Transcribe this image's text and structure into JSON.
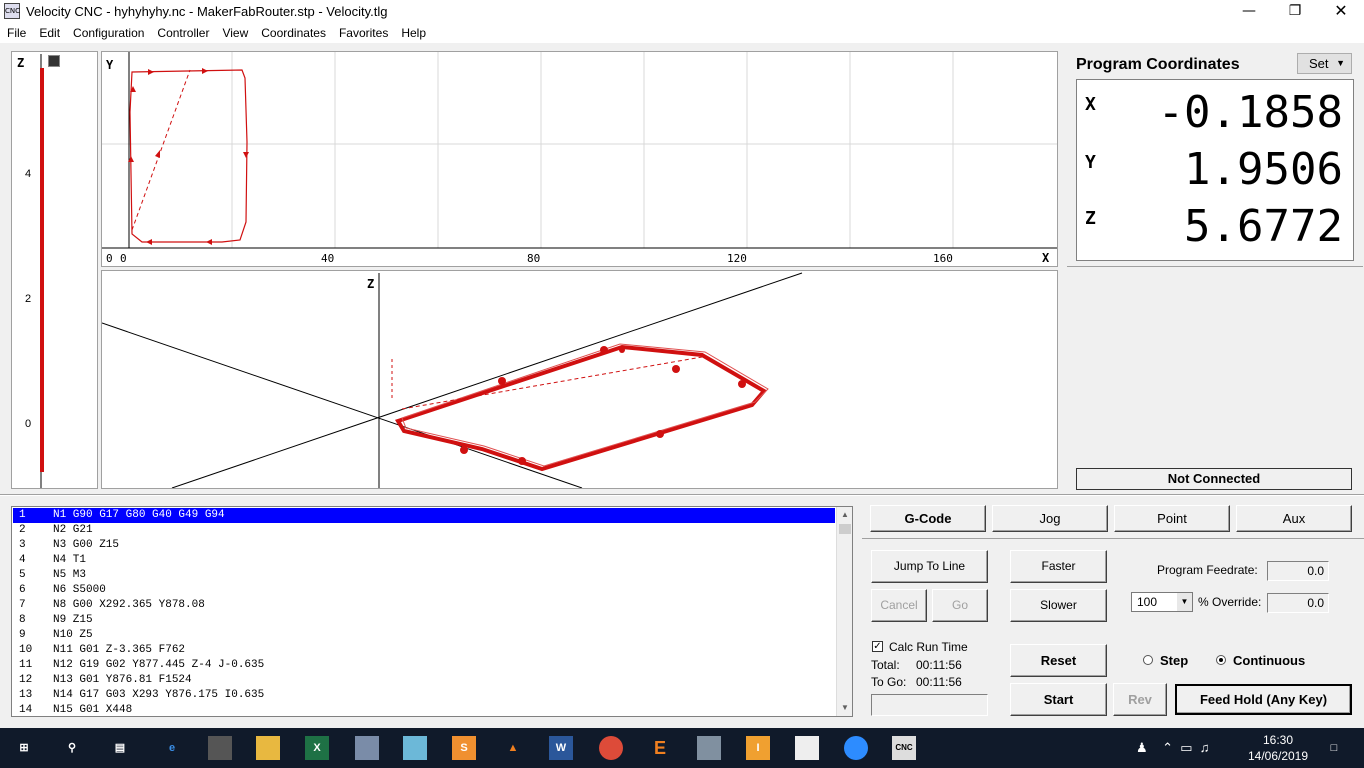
{
  "window": {
    "title": "Velocity CNC - hyhyhyhy.nc - MakerFabRouter.stp - Velocity.tlg",
    "app_icon_text": "CNC",
    "minimize_icon": "minimize-icon",
    "maximize_icon": "restore-icon",
    "close_icon": "close-icon"
  },
  "menu": [
    "File",
    "Edit",
    "Configuration",
    "Controller",
    "View",
    "Coordinates",
    "Favorites",
    "Help"
  ],
  "zbar": {
    "label": "Z",
    "ticks": [
      "4",
      "2",
      "0"
    ]
  },
  "topview": {
    "y_label": "Y",
    "x_label": "X",
    "x_ticks": [
      "0",
      "0",
      "40",
      "80",
      "120",
      "160"
    ]
  },
  "isoview": {
    "z_label": "Z"
  },
  "coords": {
    "title": "Program Coordinates",
    "set_label": "Set",
    "x_label": "X",
    "x_value": "-0.1858",
    "y_label": "Y",
    "y_value": "1.9506",
    "z_label": "Z",
    "z_value": "5.6772"
  },
  "status": "Not Connected",
  "gcode": {
    "lines": [
      {
        "n": "1",
        "code": "N1 G90 G17 G80 G40 G49 G94"
      },
      {
        "n": "2",
        "code": "N2 G21"
      },
      {
        "n": "3",
        "code": "N3 G00 Z15"
      },
      {
        "n": "4",
        "code": "N4 T1"
      },
      {
        "n": "5",
        "code": "N5 M3"
      },
      {
        "n": "6",
        "code": "N6 S5000"
      },
      {
        "n": "7",
        "code": "N8 G00 X292.365 Y878.08"
      },
      {
        "n": "8",
        "code": "N9 Z15"
      },
      {
        "n": "9",
        "code": "N10 Z5"
      },
      {
        "n": "10",
        "code": "N11 G01 Z-3.365 F762"
      },
      {
        "n": "11",
        "code": "N12 G19 G02 Y877.445 Z-4 J-0.635"
      },
      {
        "n": "12",
        "code": "N13 G01 Y876.81 F1524"
      },
      {
        "n": "13",
        "code": "N14 G17 G03 X293 Y876.175 I0.635"
      },
      {
        "n": "14",
        "code": "N15 G01 X448"
      }
    ]
  },
  "tabs": {
    "gcode": "G-Code",
    "jog": "Jog",
    "point": "Point",
    "aux": "Aux"
  },
  "controls": {
    "jump_to_line": "Jump To Line",
    "cancel": "Cancel",
    "go": "Go",
    "faster": "Faster",
    "slower": "Slower",
    "program_feedrate_label": "Program Feedrate:",
    "program_feedrate_value": "0.0",
    "override_select": "100",
    "override_label": "% Override:",
    "override_value": "0.0",
    "calc_run_time": "Calc Run Time",
    "total_label": "Total:",
    "total_value": "00:11:56",
    "to_go_label": "To Go:",
    "to_go_value": "00:11:56",
    "reset": "Reset",
    "start": "Start",
    "rev": "Rev",
    "step": "Step",
    "continuous": "Continuous",
    "feed_hold": "Feed Hold (Any Key)"
  },
  "taskbar": {
    "clock_time": "16:30",
    "clock_date": "14/06/2019",
    "icons": [
      "windows-start-icon",
      "search-icon",
      "task-view-icon",
      "edge-icon",
      "store-icon",
      "file-explorer-icon",
      "excel-icon",
      "paint-icon",
      "photos-icon",
      "sublime-icon",
      "vlc-icon",
      "word-icon",
      "chrome-icon",
      "e-app-icon",
      "tool-app-icon",
      "i-app-icon",
      "image-app-icon",
      "zoom-icon",
      "velocity-cnc-icon"
    ]
  }
}
